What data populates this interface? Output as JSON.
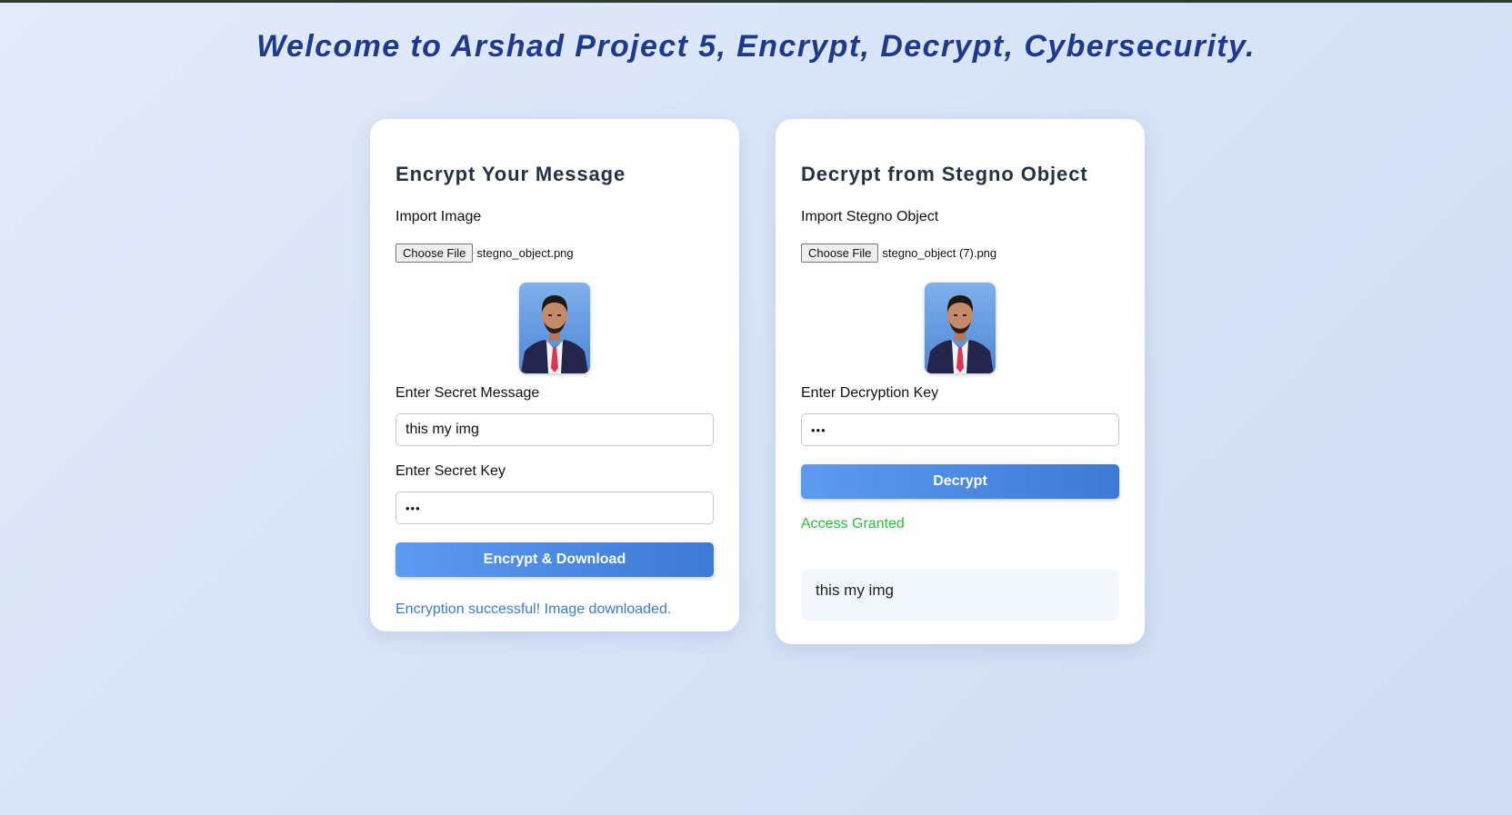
{
  "page": {
    "title": "Welcome to Arshad Project 5, Encrypt, Decrypt, Cybersecurity."
  },
  "encrypt_card": {
    "title": "Encrypt Your Message",
    "import_label": "Import Image",
    "choose_file_label": "Choose File",
    "file_name": "stegno_object.png",
    "message_label": "Enter Secret Message",
    "message_value": "this my img",
    "key_label": "Enter Secret Key",
    "key_value": "•••",
    "button_label": "Encrypt & Download",
    "status_text": "Encryption successful! Image downloaded."
  },
  "decrypt_card": {
    "title": "Decrypt from Stegno Object",
    "import_label": "Import Stegno Object",
    "choose_file_label": "Choose File",
    "file_name": "stegno_object (7).png",
    "key_label": "Enter Decryption Key",
    "key_value": "•••",
    "button_label": "Decrypt",
    "status_text": "Access Granted",
    "result_text": "this my img"
  },
  "colors": {
    "title": "#1e3a8f",
    "button_start": "#5d9bf0",
    "button_end": "#3b7ad6",
    "success_blue": "#3a7bd5",
    "success_green": "#2ebb3b"
  }
}
